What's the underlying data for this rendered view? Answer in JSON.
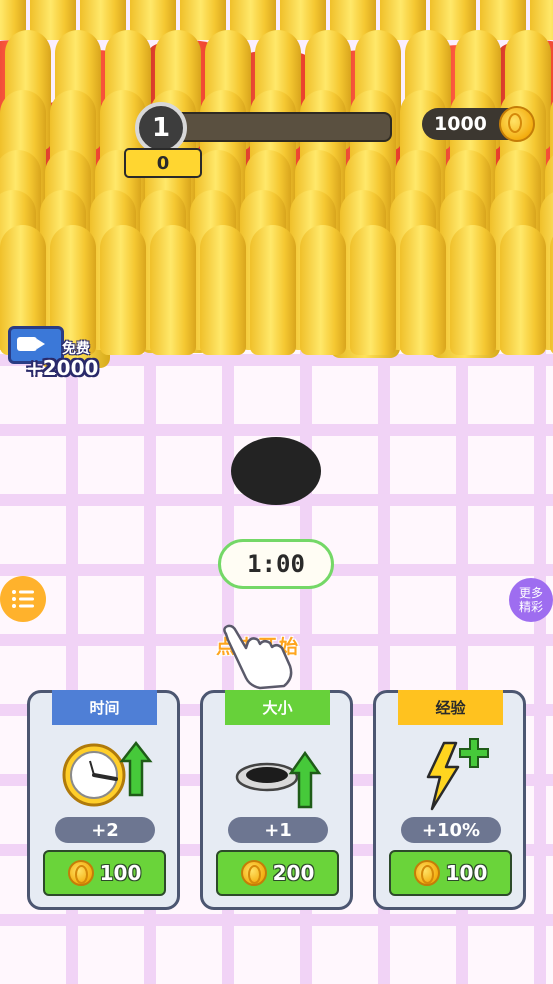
{
  "hud": {
    "level": "1",
    "score": "0",
    "coins": "1000"
  },
  "ad_reward": {
    "label": "免费",
    "amount": "+2000"
  },
  "timer": "1:00",
  "hint": "点击开始",
  "more_button": "更多\n精彩",
  "upgrades": [
    {
      "title": "时间",
      "value": "+2",
      "price": "100",
      "tab_color": "#4f7fd6",
      "icon": "clock-icon"
    },
    {
      "title": "大小",
      "value": "+1",
      "price": "200",
      "tab_color": "#67d13a",
      "icon": "hole-size-icon"
    },
    {
      "title": "经验",
      "value": "+10%",
      "price": "100",
      "tab_color": "#ffc21f",
      "icon": "lightning-icon"
    }
  ],
  "colors": {
    "bullet": "#ffd84a",
    "shell": "#ff4d38",
    "hole": "#232323",
    "timer_border": "#74d867"
  }
}
